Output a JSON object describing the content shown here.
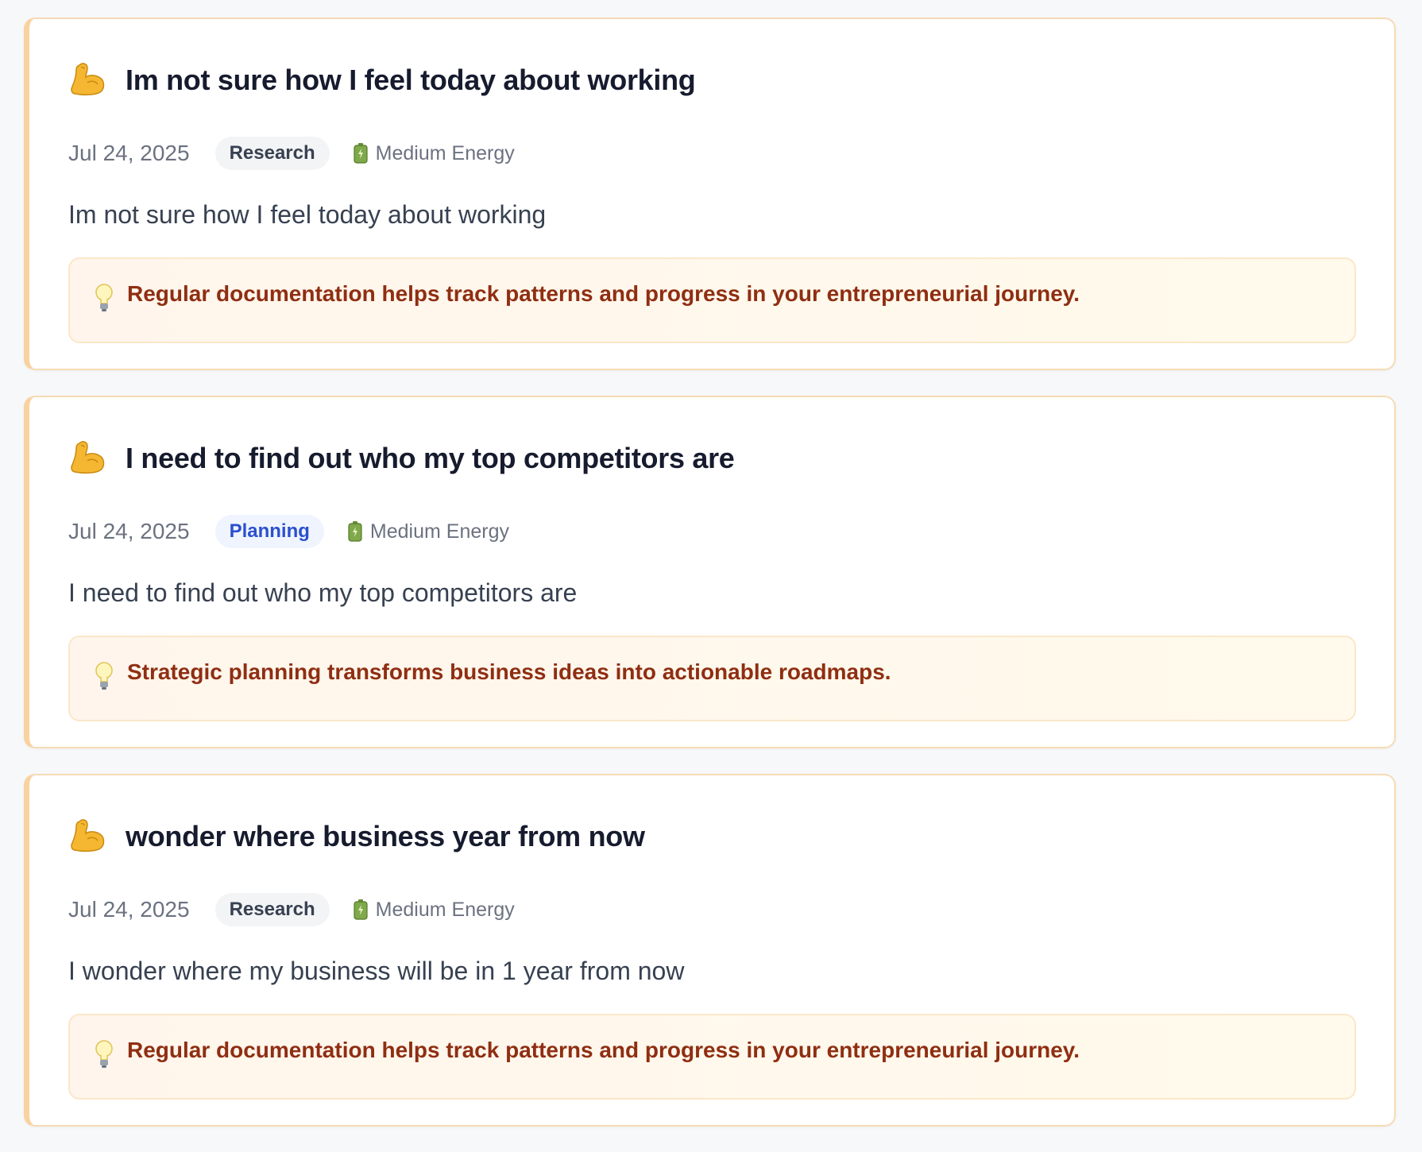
{
  "entries": [
    {
      "icon": "flexed-biceps-icon",
      "title": "Im not sure how I feel today about working",
      "date": "Jul 24, 2025",
      "tag": "Research",
      "energy_icon": "battery-icon",
      "energy": "Medium Energy",
      "content": "Im not sure how I feel today about working",
      "insight_icon": "light-bulb-icon",
      "insight": "Regular documentation helps track patterns and progress in your entrepreneurial journey."
    },
    {
      "icon": "flexed-biceps-icon",
      "title": "I need to find out who my top competitors are",
      "date": "Jul 24, 2025",
      "tag": "Planning",
      "energy_icon": "battery-icon",
      "energy": "Medium Energy",
      "content": "I need to find out who my top competitors are",
      "insight_icon": "light-bulb-icon",
      "insight": "Strategic planning transforms business ideas into actionable roadmaps."
    },
    {
      "icon": "flexed-biceps-icon",
      "title": "wonder where business year from now",
      "date": "Jul 24, 2025",
      "tag": "Research",
      "energy_icon": "battery-icon",
      "energy": "Medium Energy",
      "content": "I wonder where my business will be in 1 year from now",
      "insight_icon": "light-bulb-icon",
      "insight": "Regular documentation helps track patterns and progress in your entrepreneurial journey."
    }
  ],
  "colors": {
    "card_accent": "#f8d3a0",
    "insight_text": "#8f2e12",
    "tag_research_bg": "#f3f4f6",
    "tag_planning_bg": "#eff4ff",
    "tag_planning_text": "#2b4fce"
  }
}
